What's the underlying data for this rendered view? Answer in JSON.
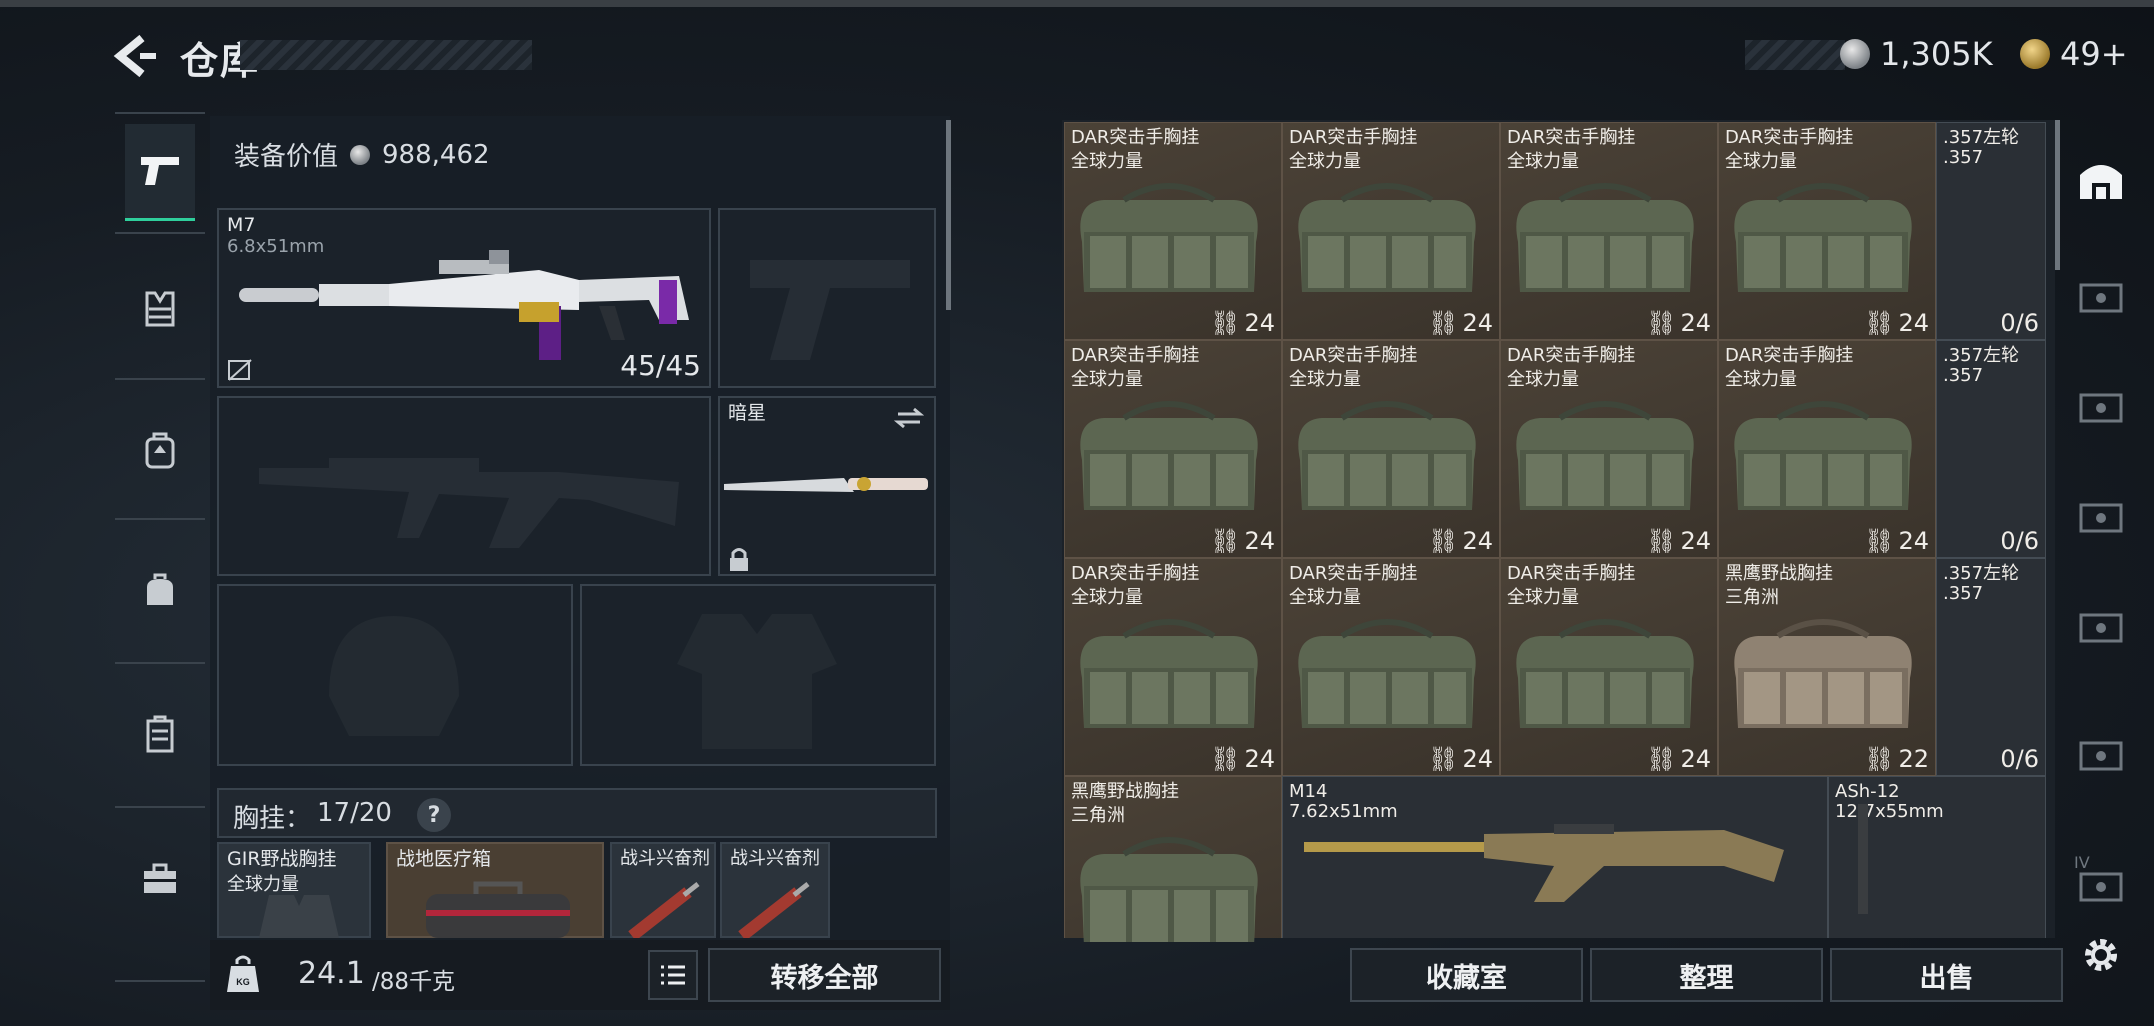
{
  "header": {
    "title": "仓库",
    "currency1": "1,305K",
    "currency2": "49+",
    "colors": {
      "accent": "#2fcf9c",
      "brown": "#4b4237"
    }
  },
  "nav": {
    "items": [
      "pistol-icon",
      "vest-icon",
      "backpack-icon",
      "bag-icon",
      "case-icon",
      "toolbox-icon"
    ]
  },
  "loadout": {
    "value_label": "装备价值",
    "value": "988,462",
    "primary": {
      "name": "M7",
      "caliber": "6.8x51mm",
      "ammo": "45/45"
    },
    "melee": {
      "name": "暗星"
    },
    "chest_rig": {
      "label": "胸挂：",
      "capacity": "17/20",
      "help": "?"
    },
    "items": [
      {
        "name1": "GIR野战胸挂",
        "name2": "全球力量"
      },
      {
        "name1": "战地医疗箱",
        "name2": ""
      },
      {
        "name1": "战斗兴奋剂",
        "name2": ""
      },
      {
        "name1": "战斗兴奋剂",
        "name2": ""
      }
    ],
    "weight": "24.1",
    "weight_max": "/88千克",
    "transfer_all": "转移全部"
  },
  "storage": {
    "rows": [
      [
        {
          "name1": "DAR突击手胸挂",
          "name2": "全球力量",
          "count": "24"
        },
        {
          "name1": "DAR突击手胸挂",
          "name2": "全球力量",
          "count": "24"
        },
        {
          "name1": "DAR突击手胸挂",
          "name2": "全球力量",
          "count": "24"
        },
        {
          "name1": "DAR突击手胸挂",
          "name2": "全球力量",
          "count": "24"
        }
      ],
      [
        {
          "name1": "DAR突击手胸挂",
          "name2": "全球力量",
          "count": "24"
        },
        {
          "name1": "DAR突击手胸挂",
          "name2": "全球力量",
          "count": "24"
        },
        {
          "name1": "DAR突击手胸挂",
          "name2": "全球力量",
          "count": "24"
        },
        {
          "name1": "DAR突击手胸挂",
          "name2": "全球力量",
          "count": "24"
        }
      ],
      [
        {
          "name1": "DAR突击手胸挂",
          "name2": "全球力量",
          "count": "24"
        },
        {
          "name1": "DAR突击手胸挂",
          "name2": "全球力量",
          "count": "24"
        },
        {
          "name1": "DAR突击手胸挂",
          "name2": "全球力量",
          "count": "24"
        },
        {
          "name1": "黑鹰野战胸挂",
          "name2": "三角洲",
          "count": "22"
        }
      ]
    ],
    "revolver": [
      {
        "name1": ".357左轮",
        "name2": ".357",
        "ammo": "0/6"
      },
      {
        "name1": ".357左轮",
        "name2": ".357",
        "ammo": "0/6"
      },
      {
        "name1": ".357左轮",
        "name2": ".357",
        "ammo": "0/6"
      }
    ],
    "bottom": [
      {
        "name1": "黑鹰野战胸挂",
        "name2": "三角洲"
      },
      {
        "name1": "M14",
        "name2": "7.62x51mm"
      },
      {
        "name1": "ASh-12",
        "name2": "12.7x55mm"
      }
    ],
    "buttons": {
      "collection": "收藏室",
      "sort": "整理",
      "sell": "出售"
    }
  },
  "sidebar": {
    "iv_label": "IV"
  }
}
